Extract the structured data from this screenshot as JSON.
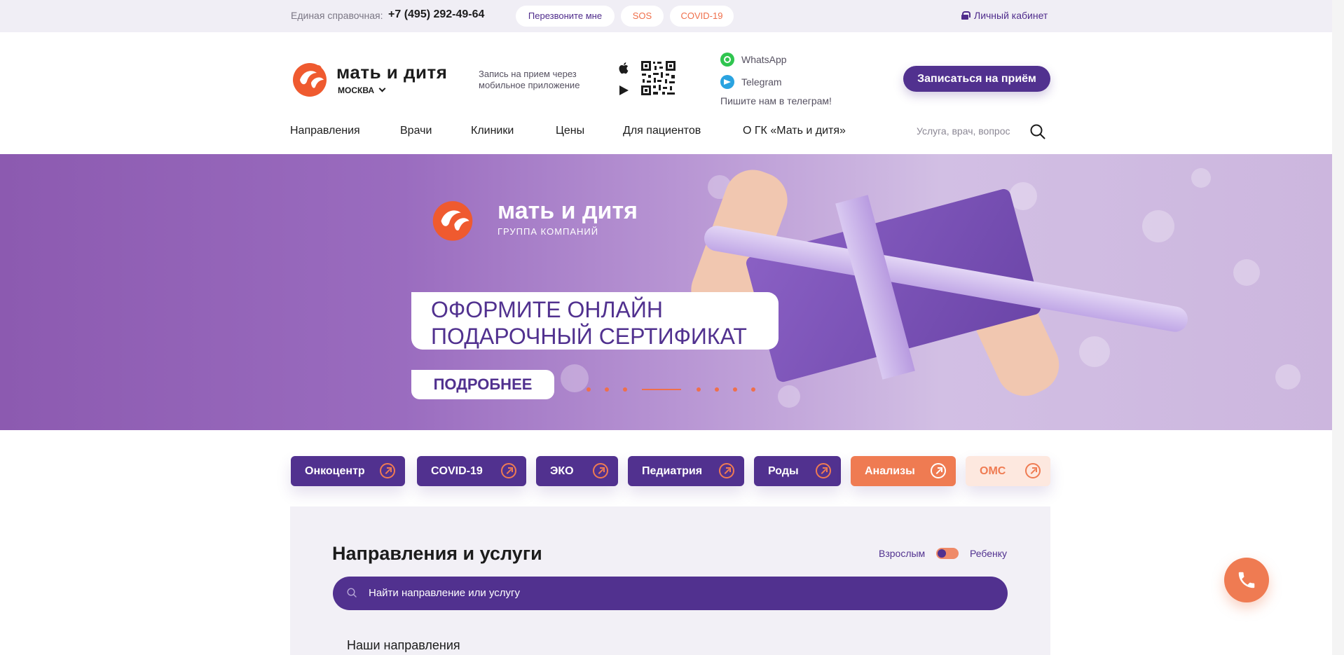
{
  "topbar": {
    "hotline_label": "Единая справочная:",
    "hotline_phone": "+7 (495) 292-49-64",
    "callback_label": "Перезвоните мне",
    "sos_label": "SOS",
    "covid_label": "COVID-19",
    "cabinet_label": "Личный кабинет",
    "cabinet_icon": "lock-icon"
  },
  "header": {
    "logo_text": "мать и дитя",
    "city": "МОСКВА",
    "app_text": "Запись на прием через мобильное приложение",
    "whatsapp_label": "WhatsApp",
    "telegram_label": "Telegram",
    "telegram_note": "Пишите нам в телеграм!",
    "book_button": "Записаться на приём",
    "search_placeholder": "Услуга, врач, вопрос",
    "nav": [
      "Направления",
      "Врачи",
      "Клиники",
      "Цены",
      "Для пациентов",
      "О ГК «Мать и дитя»"
    ]
  },
  "banner": {
    "logo_text": "мать и дитя",
    "logo_sub": "ГРУППА КОМПАНИЙ",
    "title_line1": "ОФОРМИТЕ ОНЛАЙН",
    "title_line2": "ПОДАРОЧНЫЙ СЕРТИФИКАТ",
    "button": "ПОДРОБНЕЕ"
  },
  "categories": [
    "Онкоцентр",
    "COVID-19",
    "ЭКО",
    "Педиатрия",
    "Роды",
    "Анализы",
    "ОМС"
  ],
  "section": {
    "title": "Направления и услуги",
    "toggle_adult": "Взрослым",
    "toggle_child": "Ребенку",
    "search_placeholder": "Найти направление или услугу",
    "subtitle": "Наши направления"
  },
  "colors": {
    "brand_purple": "#51318f",
    "brand_orange": "#ef7b52",
    "topbar_bg": "#f0eef5"
  }
}
